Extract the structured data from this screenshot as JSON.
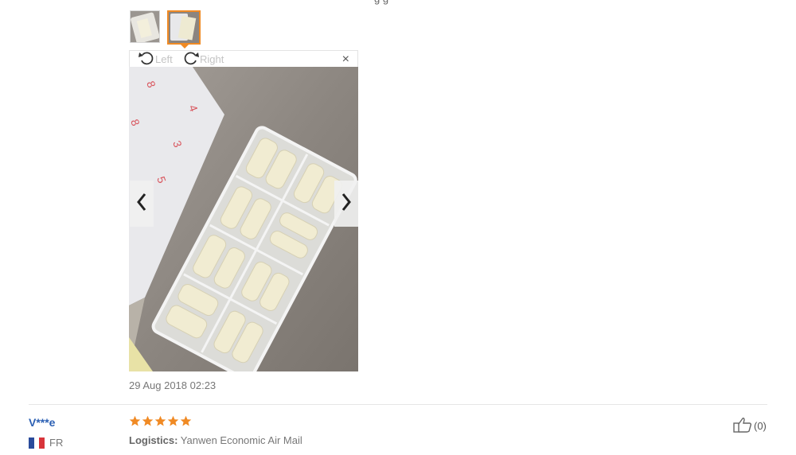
{
  "top_fragment": "g                                                              g",
  "thumbnails": [
    {
      "name": "review-photo-1"
    },
    {
      "name": "review-photo-2",
      "selected": true
    }
  ],
  "viewer": {
    "rotate_left_label": "Left",
    "rotate_right_label": "Right",
    "close_symbol": "×"
  },
  "review": {
    "date": "29 Aug 2018 02:23"
  },
  "next_review": {
    "username": "V***e",
    "country_code": "FR",
    "rating": 5,
    "logistics_label": "Logistics:",
    "logistics_value": "Yanwen Economic Air Mail",
    "helpful_count": "(0)"
  },
  "colors": {
    "accent": "#f08a24",
    "star": "#f08a24",
    "username": "#2b5fb3"
  }
}
